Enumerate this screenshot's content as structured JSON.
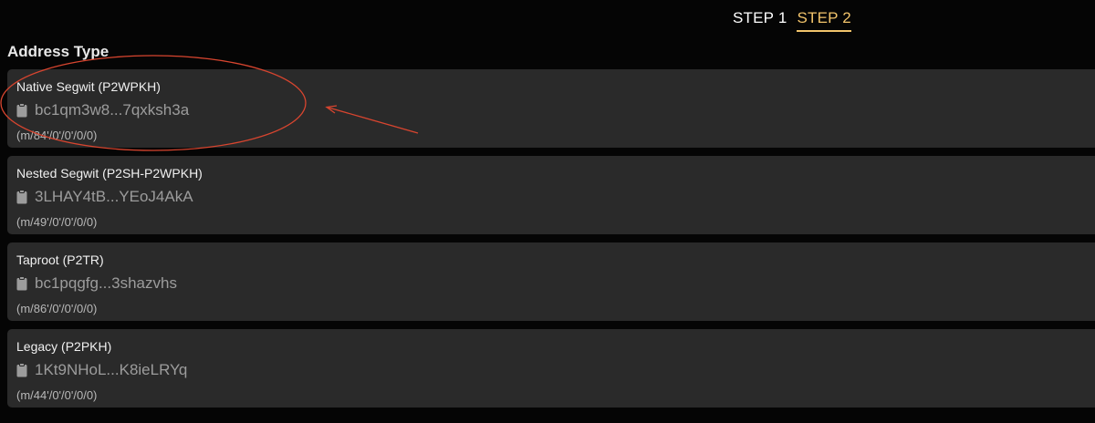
{
  "steps": [
    {
      "label": "STEP 1",
      "active": false
    },
    {
      "label": "STEP 2",
      "active": true
    }
  ],
  "section_title": "Address Type",
  "address_types": [
    {
      "name": "Native Segwit (P2WPKH)",
      "address": "bc1qm3w8...7qxksh3a",
      "path": "(m/84'/0'/0'/0/0)"
    },
    {
      "name": "Nested Segwit (P2SH-P2WPKH)",
      "address": "3LHAY4tB...YEoJ4AkA",
      "path": "(m/49'/0'/0'/0/0)"
    },
    {
      "name": "Taproot (P2TR)",
      "address": "bc1pqgfg...3shazvhs",
      "path": "(m/86'/0'/0'/0/0)"
    },
    {
      "name": "Legacy (P2PKH)",
      "address": "1Kt9NHoL...K8ieLRYq",
      "path": "(m/44'/0'/0'/0/0)"
    }
  ],
  "icons": {
    "copy": "clipboard-icon"
  },
  "colors": {
    "background": "#050505",
    "card": "#2a2a2a",
    "accent": "#f2c46b",
    "annotation": "#d8452f"
  }
}
